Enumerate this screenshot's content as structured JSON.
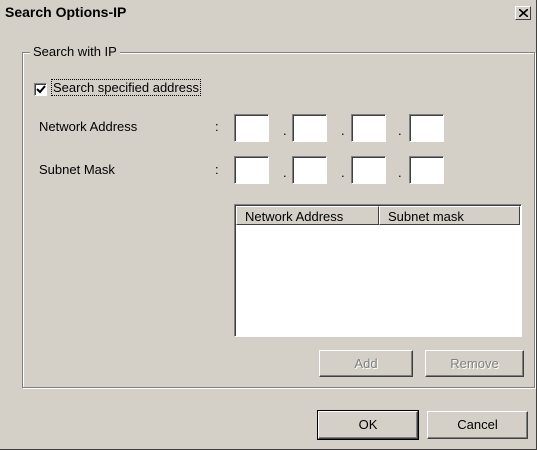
{
  "window": {
    "title": "Search Options-IP",
    "close_label": "Close"
  },
  "group": {
    "label": "Search with IP",
    "checkbox_label": "Search specified address",
    "checkbox_checked": true
  },
  "fields": {
    "colon": ":",
    "dot": ".",
    "network_address": {
      "label": "Network Address",
      "octets": [
        "",
        "",
        "",
        ""
      ]
    },
    "subnet_mask": {
      "label": "Subnet Mask",
      "octets": [
        "",
        "",
        "",
        ""
      ]
    }
  },
  "list": {
    "columns": [
      "Network Address",
      "Subnet mask"
    ],
    "rows": []
  },
  "buttons": {
    "add": "Add",
    "remove": "Remove",
    "ok": "OK",
    "cancel": "Cancel"
  }
}
